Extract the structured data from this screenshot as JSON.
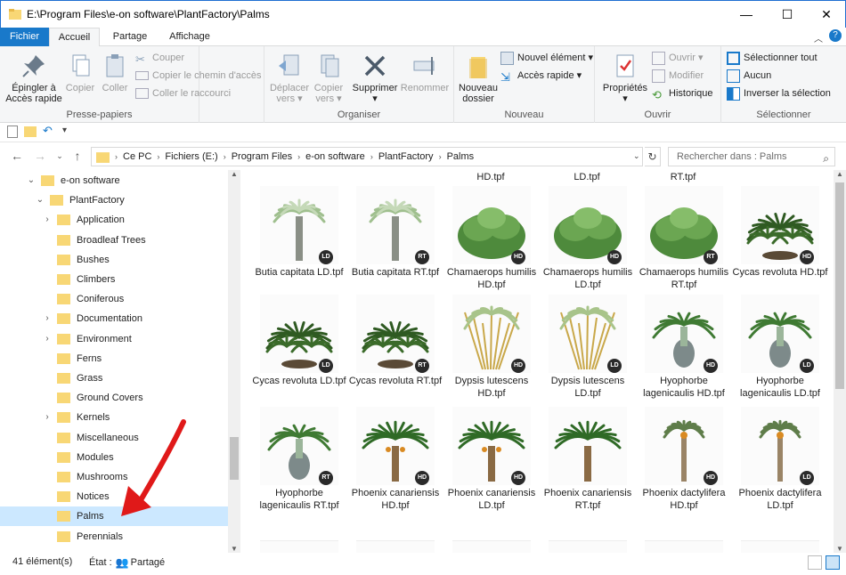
{
  "window": {
    "title": "E:\\Program Files\\e-on software\\PlantFactory\\Palms",
    "minimize": "—",
    "maximize": "☐",
    "close": "✕"
  },
  "ribbon_tabs": [
    "Fichier",
    "Accueil",
    "Partage",
    "Affichage"
  ],
  "ribbon": {
    "presse_papiers": {
      "label": "Presse-papiers",
      "pin": "Épingler à\nAccès rapide",
      "copy": "Copier",
      "paste": "Coller",
      "cut": "Couper",
      "copy_path": "Copier le chemin d'accès",
      "paste_shortcut": "Coller le raccourci"
    },
    "organiser": {
      "label": "Organiser",
      "move": "Déplacer\nvers ▾",
      "copy_to": "Copier\nvers ▾",
      "delete": "Supprimer\n▾",
      "rename": "Renommer"
    },
    "nouveau": {
      "label": "Nouveau",
      "new_folder": "Nouveau\ndossier",
      "new_item": "Nouvel élément ▾",
      "quick_access": "Accès rapide ▾"
    },
    "ouvrir": {
      "label": "Ouvrir",
      "properties": "Propriétés\n▾",
      "open": "Ouvrir ▾",
      "edit": "Modifier",
      "history": "Historique"
    },
    "selectionner": {
      "label": "Sélectionner",
      "select_all": "Sélectionner tout",
      "none": "Aucun",
      "invert": "Inverser la sélection"
    }
  },
  "address": {
    "crumbs": [
      "Ce PC",
      "Fichiers (E:)",
      "Program Files",
      "e-on software",
      "PlantFactory",
      "Palms"
    ],
    "search_placeholder": "Rechercher dans : Palms"
  },
  "tree": [
    {
      "label": "e-on software",
      "level": 1,
      "chevron": "⌄"
    },
    {
      "label": "PlantFactory",
      "level": 2,
      "chevron": "⌄"
    },
    {
      "label": "Application",
      "level": 3,
      "chevron": "›"
    },
    {
      "label": "Broadleaf Trees",
      "level": 3,
      "chevron": ""
    },
    {
      "label": "Bushes",
      "level": 3,
      "chevron": ""
    },
    {
      "label": "Climbers",
      "level": 3,
      "chevron": ""
    },
    {
      "label": "Coniferous",
      "level": 3,
      "chevron": ""
    },
    {
      "label": "Documentation",
      "level": 3,
      "chevron": "›"
    },
    {
      "label": "Environment",
      "level": 3,
      "chevron": "›"
    },
    {
      "label": "Ferns",
      "level": 3,
      "chevron": ""
    },
    {
      "label": "Grass",
      "level": 3,
      "chevron": ""
    },
    {
      "label": "Ground Covers",
      "level": 3,
      "chevron": ""
    },
    {
      "label": "Kernels",
      "level": 3,
      "chevron": "›"
    },
    {
      "label": "Miscellaneous",
      "level": 3,
      "chevron": ""
    },
    {
      "label": "Modules",
      "level": 3,
      "chevron": ""
    },
    {
      "label": "Mushrooms",
      "level": 3,
      "chevron": ""
    },
    {
      "label": "Notices",
      "level": 3,
      "chevron": ""
    },
    {
      "label": "Palms",
      "level": 3,
      "chevron": "",
      "selected": true
    },
    {
      "label": "Perennials",
      "level": 3,
      "chevron": ""
    }
  ],
  "top_partial_labels": [
    "HD.tpf",
    "LD.tpf",
    "RT.tpf"
  ],
  "files": [
    {
      "name": "Butia capitata LD.tpf",
      "badge": "LD",
      "kind": "palm-tall"
    },
    {
      "name": "Butia capitata RT.tpf",
      "badge": "RT",
      "kind": "palm-tall"
    },
    {
      "name": "Chamaerops humilis HD.tpf",
      "badge": "HD",
      "kind": "bush"
    },
    {
      "name": "Chamaerops humilis LD.tpf",
      "badge": "HD",
      "kind": "bush"
    },
    {
      "name": "Chamaerops humilis RT.tpf",
      "badge": "RT",
      "kind": "bush"
    },
    {
      "name": "Cycas revoluta HD.tpf",
      "badge": "HD",
      "kind": "cycas"
    },
    {
      "name": "Cycas revoluta LD.tpf",
      "badge": "LD",
      "kind": "cycas"
    },
    {
      "name": "Cycas revoluta RT.tpf",
      "badge": "RT",
      "kind": "cycas"
    },
    {
      "name": "Dypsis lutescens HD.tpf",
      "badge": "HD",
      "kind": "dypsis"
    },
    {
      "name": "Dypsis lutescens LD.tpf",
      "badge": "LD",
      "kind": "dypsis"
    },
    {
      "name": "Hyophorbe lagenicaulis HD.tpf",
      "badge": "HD",
      "kind": "hyophorbe"
    },
    {
      "name": "Hyophorbe lagenicaulis LD.tpf",
      "badge": "LD",
      "kind": "hyophorbe"
    },
    {
      "name": "Hyophorbe lagenicaulis RT.tpf",
      "badge": "RT",
      "kind": "hyophorbe"
    },
    {
      "name": "Phoenix canariensis HD.tpf",
      "badge": "HD",
      "kind": "phoenix"
    },
    {
      "name": "Phoenix canariensis LD.tpf",
      "badge": "HD",
      "kind": "phoenix"
    },
    {
      "name": "Phoenix canariensis RT.tpf",
      "badge": "",
      "kind": "phoenix-rt"
    },
    {
      "name": "Phoenix dactylifera HD.tpf",
      "badge": "HD",
      "kind": "dactylifera"
    },
    {
      "name": "Phoenix dactylifera LD.tpf",
      "badge": "LD",
      "kind": "dactylifera"
    }
  ],
  "status": {
    "count": "41 élément(s)",
    "state_label": "État :",
    "state_value": "Partagé"
  },
  "colors": {
    "accent": "#1979ca",
    "selection": "#cce8ff",
    "folder": "#f8d775",
    "arrow": "#e01919"
  }
}
